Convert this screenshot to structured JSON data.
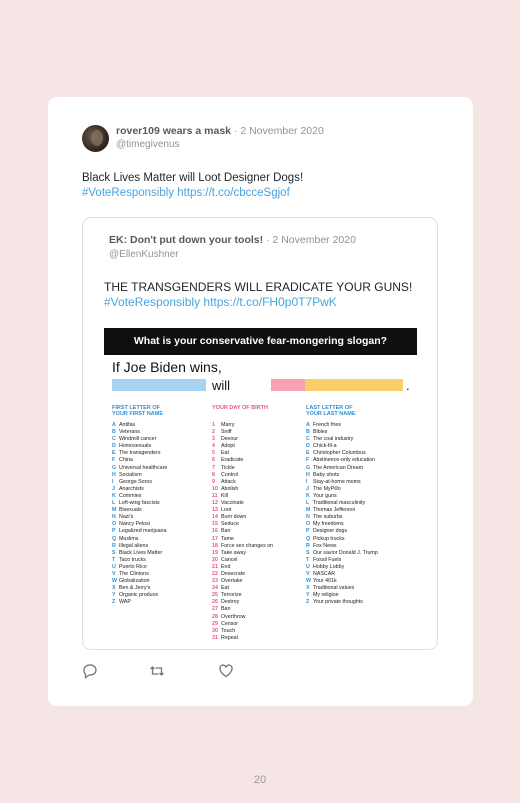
{
  "tweet": {
    "name": "rover109 wears a mask",
    "date": " · 2 November 2020",
    "handle": "@timegivenus",
    "text": "Black Lives Matter will Loot Designer Dogs!",
    "hashtag": "#VoteResponsibly",
    "url": " https://t.co/cbcceSgjof"
  },
  "quoted": {
    "name": "EK: Don't put down your tools!",
    "date": " · 2 November 2020",
    "handle": "@EllenKushner",
    "text": "THE TRANSGENDERS WILL ERADICATE YOUR GUNS!",
    "hashtag": " #VoteResponsibly",
    "url": " https://t.co/FH0p0T7PwK"
  },
  "meme": {
    "title": "What is your conservative fear-mongering slogan?",
    "prompt": "If Joe Biden wins,",
    "will": "will",
    "period": ".",
    "col1_title": [
      "FIRST LETTER OF",
      "YOUR FIRST NAME"
    ],
    "col2_title": [
      "YOUR DAY OF BIRTH"
    ],
    "col3_title": [
      "LAST LETTER OF",
      "YOUR LAST NAME"
    ],
    "col1": [
      [
        "A",
        "Antifas"
      ],
      [
        "B",
        "Veterans"
      ],
      [
        "C",
        "Windmill cancer"
      ],
      [
        "D",
        "Homosexuals"
      ],
      [
        "E",
        "The transgenders"
      ],
      [
        "F",
        "China"
      ],
      [
        "G",
        "Universal healthcare"
      ],
      [
        "H",
        "Socialism"
      ],
      [
        "I",
        "George Soros"
      ],
      [
        "J",
        "Anarchists"
      ],
      [
        "K",
        "Commies"
      ],
      [
        "L",
        "Left-wing fascists"
      ],
      [
        "M",
        "Bisexuals"
      ],
      [
        "N",
        "Nazi's"
      ],
      [
        "O",
        "Nancy Pelosi"
      ],
      [
        "P",
        "Legalized marijuana"
      ],
      [
        "Q",
        "Muslims"
      ],
      [
        "R",
        "Illegal aliens"
      ],
      [
        "S",
        "Black Lives Matter"
      ],
      [
        "T",
        "Taco trucks"
      ],
      [
        "U",
        "Puerto Rico"
      ],
      [
        "V",
        "The Clintons"
      ],
      [
        "W",
        "Globalization"
      ],
      [
        "X",
        "Ben & Jerry's"
      ],
      [
        "Y",
        "Organic produce"
      ],
      [
        "Z",
        "WAP"
      ]
    ],
    "col2": [
      [
        "1",
        "Marry"
      ],
      [
        "2",
        "Sniff"
      ],
      [
        "3",
        "Devour"
      ],
      [
        "4",
        "Adopt"
      ],
      [
        "5",
        "Eat"
      ],
      [
        "6",
        "Eradicate"
      ],
      [
        "7",
        "Tickle"
      ],
      [
        "8",
        "Control"
      ],
      [
        "9",
        "Attack"
      ],
      [
        "10",
        "Abolish"
      ],
      [
        "11",
        "Kill"
      ],
      [
        "12",
        "Vaccinate"
      ],
      [
        "13",
        "Loot"
      ],
      [
        "14",
        "Burn down"
      ],
      [
        "15",
        "Seduce"
      ],
      [
        "16",
        "Ban"
      ],
      [
        "17",
        "Tame"
      ],
      [
        "18",
        "Force sex changes on"
      ],
      [
        "19",
        "Take away"
      ],
      [
        "20",
        "Cancel"
      ],
      [
        "21",
        "End"
      ],
      [
        "22",
        "Desecrate"
      ],
      [
        "23",
        "Overtake"
      ],
      [
        "24",
        "Eat"
      ],
      [
        "25",
        "Terrorize"
      ],
      [
        "26",
        "Destroy"
      ],
      [
        "27",
        "Ban"
      ],
      [
        "28",
        "Overthrow"
      ],
      [
        "29",
        "Censor"
      ],
      [
        "30",
        "Touch"
      ],
      [
        "31",
        "Repeal"
      ]
    ],
    "col3": [
      [
        "A",
        "French fries"
      ],
      [
        "B",
        "Bibles"
      ],
      [
        "C",
        "The coal industry"
      ],
      [
        "D",
        "Chick-fil-a"
      ],
      [
        "E",
        "Christopher Columbus"
      ],
      [
        "F",
        "Abstinence-only education"
      ],
      [
        "G",
        "The American Dream"
      ],
      [
        "H",
        "Baby shots"
      ],
      [
        "I",
        "Stay-at-home moms"
      ],
      [
        "J",
        "The MyPillo"
      ],
      [
        "K",
        "Your guns"
      ],
      [
        "L",
        "Traditional masculinity"
      ],
      [
        "M",
        "Thomas Jefferson"
      ],
      [
        "N",
        "The suburbs"
      ],
      [
        "O",
        "My freedoms"
      ],
      [
        "P",
        "Designer dogs"
      ],
      [
        "Q",
        "Pickup trucks"
      ],
      [
        "R",
        "Fox News"
      ],
      [
        "S",
        "Our savior Donald J. Trump"
      ],
      [
        "T",
        "Fossil Fuels"
      ],
      [
        "U",
        "Hobby Lobby"
      ],
      [
        "V",
        "NASCAR"
      ],
      [
        "W",
        "Your 401k"
      ],
      [
        "X",
        "Traditional values"
      ],
      [
        "Y",
        "My religion"
      ],
      [
        "Z",
        "Your private thoughts"
      ]
    ]
  },
  "actions": [
    "reply-icon",
    "retweet-icon",
    "like-icon"
  ],
  "page_number": "20",
  "colors": {
    "background": "#f5e5e4",
    "link": "#4aa3df",
    "blank_blue": "#a9d3f2",
    "blank_pink": "#f7a1b4",
    "blank_yellow": "#f8cf6a"
  }
}
